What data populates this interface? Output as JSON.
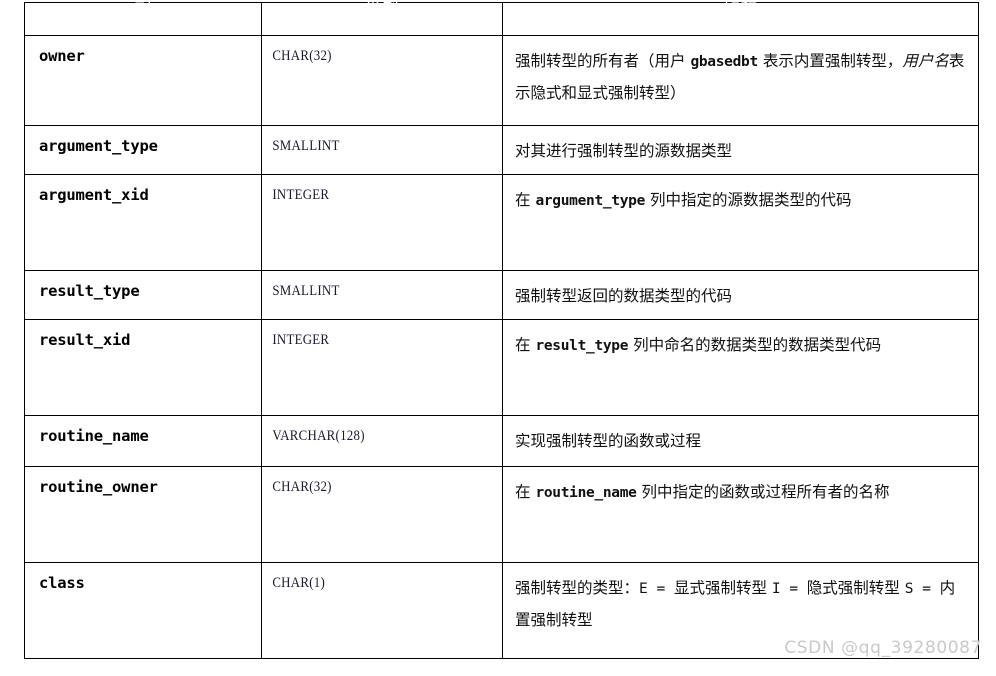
{
  "table": {
    "headers": [
      "列",
      "类型",
      "解释"
    ],
    "rows": [
      {
        "name": "owner",
        "type": "CHAR(32)",
        "desc_html": "强制转型的所有者（用户 <span class=\"code\">gbasedbt</span> 表示内置强制转型，<span class=\"ital\">用户名</span>表示隐式和显式强制转型）",
        "desc_text": "强制转型的所有者（用户 gbasedbt 表示内置强制转型，用户名表示隐式和显式强制转型）",
        "height_class": "r-tall3"
      },
      {
        "name": "argument_type",
        "type": "SMALLINT",
        "desc_html": "对其进行强制转型的源数据类型",
        "desc_text": "对其进行强制转型的源数据类型",
        "height_class": "r-short"
      },
      {
        "name": "argument_xid",
        "type": "INTEGER",
        "desc_html": "在 <span class=\"code\">argument_type</span> 列中指定的源数据类型的代码",
        "desc_text": "在 argument_type 列中指定的源数据类型的代码",
        "height_class": "r-tall"
      },
      {
        "name": "result_type",
        "type": "SMALLINT",
        "desc_html": "强制转型返回的数据类型的代码",
        "desc_text": "强制转型返回的数据类型的代码",
        "height_class": "r-short"
      },
      {
        "name": "result_xid",
        "type": "INTEGER",
        "desc_html": "在 <span class=\"code\">result_type</span> 列中命名的数据类型的数据类型代码",
        "desc_text": "在 result_type 列中命名的数据类型的数据类型代码",
        "height_class": "r-tall"
      },
      {
        "name": "routine_name",
        "type": "VARCHAR(128)",
        "desc_html": "实现强制转型的函数或过程",
        "desc_text": "实现强制转型的函数或过程",
        "height_class": "r-tall2"
      },
      {
        "name": "routine_owner",
        "type": "CHAR(32)",
        "desc_html": "在 <span class=\"code\">routine_name</span> 列中指定的函数或过程所有者的名称",
        "desc_text": "在 routine_name 列中指定的函数或过程所有者的名称",
        "height_class": "r-tall"
      },
      {
        "name": "class",
        "type": "CHAR(1)",
        "desc_html": "强制转型的类型：<span class=\"mono\">E = </span>显式强制转型 <span class=\"mono\">I = </span>隐式强制转型 <span class=\"mono\">S = </span>内置强制转型",
        "desc_text": "强制转型的类型：E = 显式强制转型 I = 隐式强制转型 S = 内置强制转型",
        "height_class": "r-last"
      }
    ]
  },
  "watermark": {
    "text": "CSDN @qq_39280087"
  },
  "colors": {
    "header_background": "#a8a8a8",
    "header_text": "#ffffff",
    "border": "#000000",
    "cell_background": "#ffffff",
    "body_text": "#111111",
    "type_text": "#1a1a2e",
    "watermark_text": "#c9c9c9"
  }
}
